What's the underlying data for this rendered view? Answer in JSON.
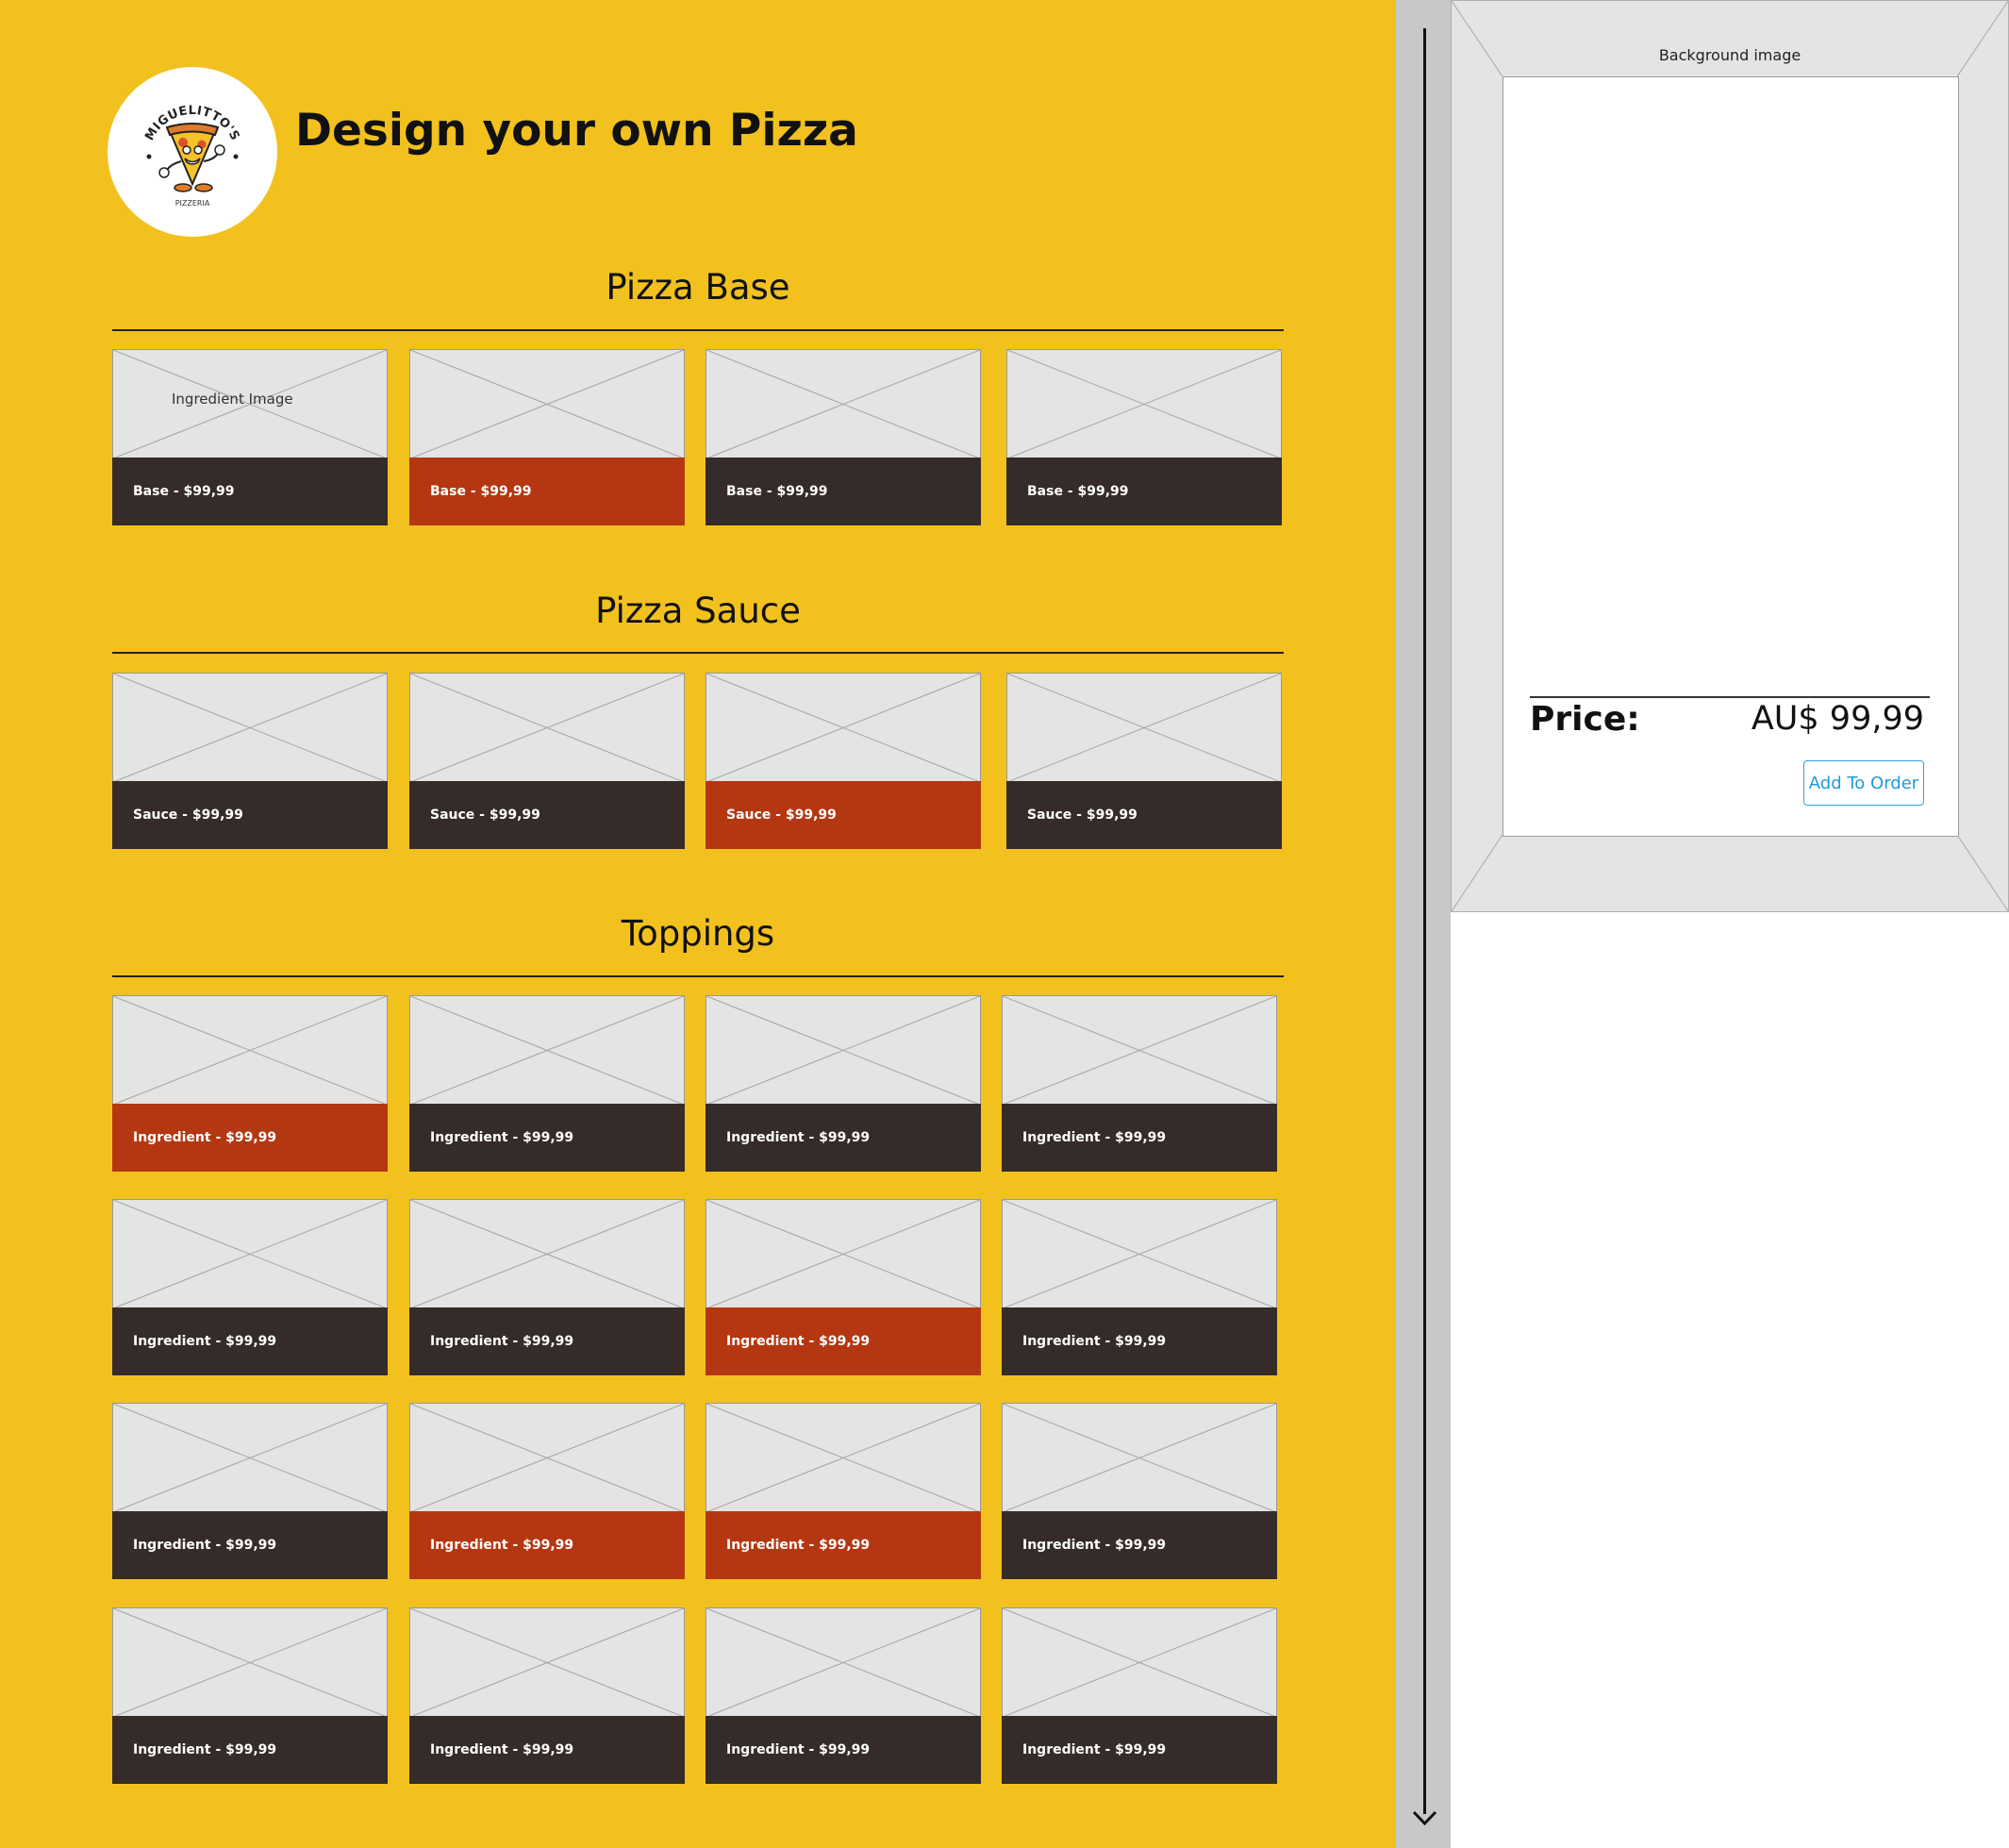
{
  "header": {
    "title": "Design your own Pizza",
    "logo": {
      "brand": "MIGUELITTO'S",
      "subtitle": "PIZZERIA",
      "icon": "pizza-mascot-icon"
    }
  },
  "sections": [
    {
      "title": "Pizza Base",
      "cards": [
        {
          "label": "Base - $99,99",
          "image_label": "Ingredient Image",
          "selected": false
        },
        {
          "label": "Base - $99,99",
          "selected": true
        },
        {
          "label": "Base - $99,99",
          "selected": false
        },
        {
          "label": "Base - $99,99",
          "selected": false
        }
      ]
    },
    {
      "title": "Pizza Sauce",
      "cards": [
        {
          "label": "Sauce - $99,99",
          "selected": false
        },
        {
          "label": "Sauce - $99,99",
          "selected": false
        },
        {
          "label": "Sauce - $99,99",
          "selected": true
        },
        {
          "label": "Sauce - $99,99",
          "selected": false
        }
      ]
    },
    {
      "title": "Toppings",
      "cards": [
        {
          "label": "Ingredient - $99,99",
          "selected": true
        },
        {
          "label": "Ingredient - $99,99",
          "selected": false
        },
        {
          "label": "Ingredient - $99,99",
          "selected": false
        },
        {
          "label": "Ingredient - $99,99",
          "selected": false
        },
        {
          "label": "Ingredient - $99,99",
          "selected": false
        },
        {
          "label": "Ingredient - $99,99",
          "selected": false
        },
        {
          "label": "Ingredient - $99,99",
          "selected": true
        },
        {
          "label": "Ingredient - $99,99",
          "selected": false
        },
        {
          "label": "Ingredient - $99,99",
          "selected": false
        },
        {
          "label": "Ingredient - $99,99",
          "selected": true
        },
        {
          "label": "Ingredient - $99,99",
          "selected": true
        },
        {
          "label": "Ingredient - $99,99",
          "selected": false
        },
        {
          "label": "Ingredient - $99,99",
          "selected": false
        },
        {
          "label": "Ingredient - $99,99",
          "selected": false
        },
        {
          "label": "Ingredient - $99,99",
          "selected": false
        },
        {
          "label": "Ingredient - $99,99",
          "selected": false
        }
      ]
    }
  ],
  "summary": {
    "background_label": "Background image",
    "price_label": "Price:",
    "price_value": "AU$ 99,99",
    "add_button": "Add To Order"
  },
  "scrollbar": {
    "icon": "scroll-down-arrow-icon"
  },
  "colors": {
    "page_background": "#f2c11e",
    "card_bar": "#352b29",
    "card_bar_selected": "#b43712",
    "placeholder": "#e4e4e4",
    "button_accent": "#1e9ade"
  }
}
